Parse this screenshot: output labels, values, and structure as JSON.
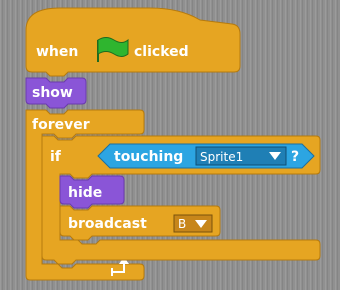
{
  "script": {
    "hat": {
      "label_before": "when",
      "label_after": "clicked",
      "icon": "green-flag-icon"
    },
    "show": {
      "label": "show"
    },
    "forever": {
      "label": "forever"
    },
    "if": {
      "label": "if",
      "condition": {
        "label": "touching",
        "dropdown_value": "Sprite1",
        "question": "?"
      }
    },
    "hide": {
      "label": "hide"
    },
    "broadcast": {
      "label": "broadcast",
      "dropdown_value": "B"
    },
    "loop_arrow_icon": "loop-arrow-icon"
  },
  "colors": {
    "control": "#e6a522",
    "control_dark": "#b57a0e",
    "looks": "#8a55d7",
    "looks_dark": "#6a3aad",
    "sensing": "#2ca5e2",
    "sensing_dark": "#1b6fa0",
    "flag_green": "#2fb52f"
  }
}
